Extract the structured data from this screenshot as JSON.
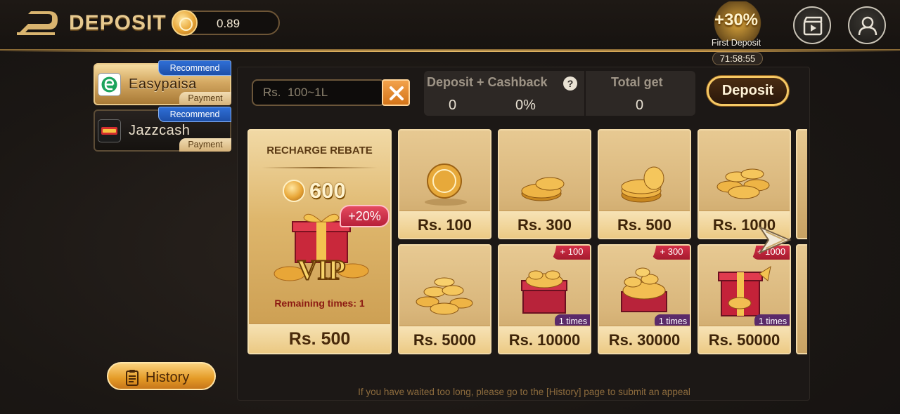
{
  "header": {
    "title": "DEPOSIT",
    "balance": "0.89",
    "first_deposit": {
      "percent": "+30%",
      "label": "First Deposit",
      "timer": "71:58:55"
    }
  },
  "sidebar": {
    "methods": [
      {
        "name": "Easypaisa",
        "recommend": "Recommend",
        "tag": "Payment",
        "selected": true
      },
      {
        "name": "Jazzcash",
        "recommend": "Recommend",
        "tag": "Payment",
        "selected": false
      }
    ],
    "history_label": "History"
  },
  "form": {
    "amount_placeholder": "Rs.  100~1L",
    "summary": {
      "deposit_cashback_label": "Deposit + Cashback",
      "deposit_value": "0",
      "cashback_value": "0%",
      "total_label": "Total get",
      "total_value": "0"
    },
    "deposit_button": "Deposit"
  },
  "rebate": {
    "title": "RECHARGE REBATE",
    "amount": "600",
    "bonus": "+20%",
    "vip": "VIP",
    "remaining": "Remaining times: 1",
    "price": "Rs. 500"
  },
  "tiles": [
    {
      "price": "Rs. 100",
      "art": "single-coin"
    },
    {
      "price": "Rs. 300",
      "art": "coin-pair"
    },
    {
      "price": "Rs. 500",
      "art": "coin-stack"
    },
    {
      "price": "Rs. 1000",
      "art": "coin-pile"
    },
    {
      "price": "Rs. 5000",
      "art": "coin-heap"
    },
    {
      "price": "Rs. 10000",
      "art": "treasure-chest",
      "bonus": "+ 100",
      "times": "1 times"
    },
    {
      "price": "Rs. 30000",
      "art": "coin-cart",
      "bonus": "+ 300",
      "times": "1 times"
    },
    {
      "price": "Rs. 50000",
      "art": "gift-box",
      "bonus": "+ 1000",
      "times": "1 times"
    }
  ],
  "footer_note": "If you have waited too long, please go to the [History] page to submit an appeal",
  "colors": {
    "gold": "#e6c98f",
    "recommend_blue": "#2f6fd6",
    "bonus_red": "#d9324a",
    "times_purple": "#5a2a6a"
  }
}
